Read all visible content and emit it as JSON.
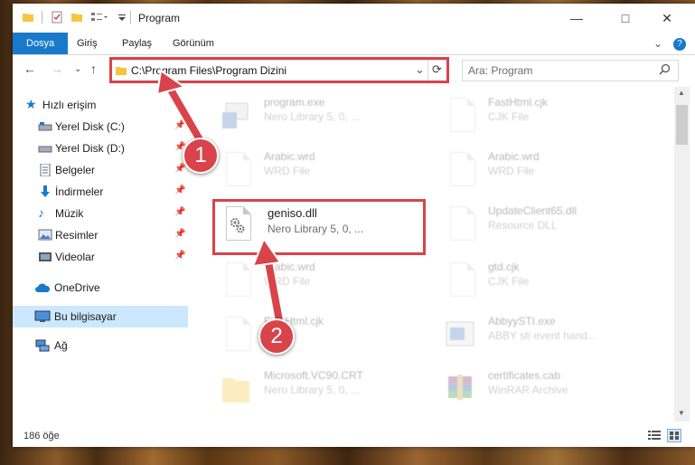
{
  "window": {
    "title": "Program",
    "controls": [
      "minimize-icon",
      "maximize-icon",
      "close-icon"
    ]
  },
  "ribbon": {
    "tabs": [
      {
        "label": "Dosya",
        "active": true
      },
      {
        "label": "Giriş"
      },
      {
        "label": "Paylaş"
      },
      {
        "label": "Görünüm"
      }
    ]
  },
  "address": {
    "path": "C:\\Program Files\\Program Dizini",
    "search_placeholder": "Ara: Program"
  },
  "sidebar": {
    "items": [
      {
        "label": "Hızlı erişim",
        "icon": "star-icon"
      },
      {
        "label": "Yerel Disk (C:)",
        "icon": "drive-icon",
        "pinned": true
      },
      {
        "label": "Yerel Disk (D:)",
        "icon": "drive-icon",
        "pinned": true
      },
      {
        "label": "Belgeler",
        "icon": "documents-icon",
        "pinned": true
      },
      {
        "label": "İndirmeler",
        "icon": "download-icon",
        "pinned": true
      },
      {
        "label": "Müzik",
        "icon": "music-icon",
        "pinned": true
      },
      {
        "label": "Resimler",
        "icon": "pictures-icon",
        "pinned": true
      },
      {
        "label": "Videolar",
        "icon": "video-icon",
        "pinned": true
      },
      {
        "label": "OneDrive",
        "icon": "cloud-icon"
      },
      {
        "label": "Bu bilgisayar",
        "icon": "computer-icon",
        "selected": true
      },
      {
        "label": "Ağ",
        "icon": "network-icon"
      }
    ]
  },
  "files": [
    {
      "name": "program.exe",
      "desc": "Nero Library 5, 0, ...",
      "icon": "exe-icon"
    },
    {
      "name": "FastHtml.cjk",
      "desc": "CJK File",
      "icon": "document-icon"
    },
    {
      "name": "Arabic.wrd",
      "desc": "WRD File",
      "icon": "document-icon"
    },
    {
      "name": "Arabic.wrd",
      "desc": "WRD File",
      "icon": "document-icon"
    },
    {
      "name": "geniso.dll",
      "desc": "Nero Library 5, 0, ...",
      "icon": "dll-gear-icon",
      "highlighted": true
    },
    {
      "name": "UpdateClient65.dll",
      "desc": "Resource DLL",
      "icon": "dll-gear-icon"
    },
    {
      "name": "Arabic.wrd",
      "desc": "WRD File",
      "icon": "document-icon"
    },
    {
      "name": "gtd.cjk",
      "desc": "CJK File",
      "icon": "document-icon"
    },
    {
      "name": "FastHtml.cjk",
      "desc": "",
      "icon": "document-icon"
    },
    {
      "name": "AbbyySTI.exe",
      "desc": "ABBY sti event hand...",
      "icon": "exe-icon"
    },
    {
      "name": "Microsoft.VC90.CRT",
      "desc": "Nero Library 5, 0, ...",
      "icon": "folder-icon"
    },
    {
      "name": "certificates.cab",
      "desc": "WinRAR Archive",
      "icon": "winrar-icon"
    }
  ],
  "annotations": {
    "step1": "1",
    "step2": "2"
  },
  "status": {
    "count": "186 öğe"
  },
  "colors": {
    "accent": "#1979ca",
    "highlight": "#d9434a",
    "selected": "#cce8ff"
  }
}
